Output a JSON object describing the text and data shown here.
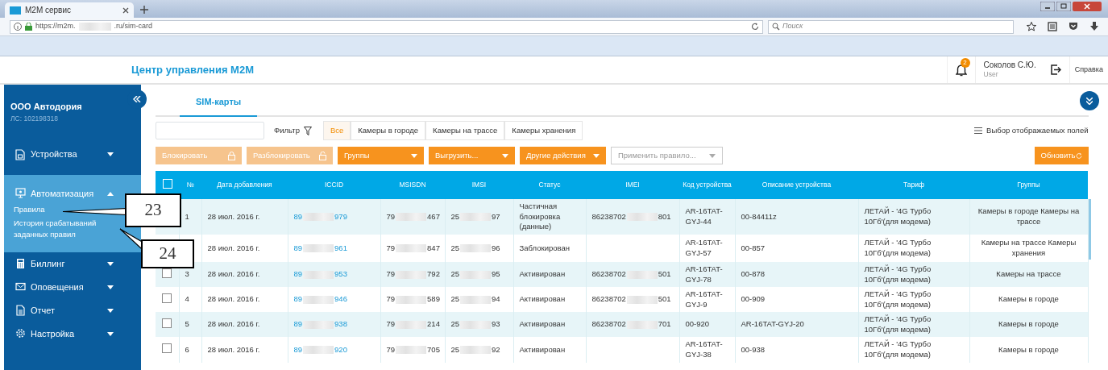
{
  "browser": {
    "tab_title": "M2M сервис",
    "url_start": "https://m2m.",
    "url_end": ".ru/sim-card",
    "search_placeholder": "Поиск"
  },
  "header": {
    "title": "Центр управления M2M",
    "notifications": "2",
    "user_name": "Соколов С.Ю.",
    "user_role": "User",
    "help": "Справка"
  },
  "sidebar": {
    "org": "ООО Автодория",
    "account": "ЛС: 102198318",
    "items": [
      {
        "label": "Устройства",
        "expanded": false
      },
      {
        "label": "Автоматизация",
        "expanded": true,
        "children": [
          {
            "label": "Правила"
          },
          {
            "label": "История срабатываний заданных правил"
          }
        ]
      },
      {
        "label": "Биллинг",
        "expanded": false
      },
      {
        "label": "Оповещения",
        "expanded": false
      },
      {
        "label": "Отчет",
        "expanded": false
      },
      {
        "label": "Настройка",
        "expanded": false
      }
    ]
  },
  "tabs": [
    {
      "label": "SIM-карты",
      "selected": true
    }
  ],
  "filter": {
    "label": "Фильтр",
    "segments": [
      {
        "label": "Все",
        "selected": true
      },
      {
        "label": "Камеры в городе",
        "selected": false
      },
      {
        "label": "Камеры на трассе",
        "selected": false
      },
      {
        "label": "Камеры хранения",
        "selected": false
      }
    ],
    "fields_link": "Выбор отображаемых полей"
  },
  "actions": [
    {
      "label": "Блокировать",
      "kind": "lock",
      "disabled": true
    },
    {
      "label": "Разблокировать",
      "kind": "unlock",
      "disabled": true
    },
    {
      "label": "Группы",
      "kind": "dropdown",
      "disabled": false
    },
    {
      "label": "Выгрузить...",
      "kind": "dropdown",
      "disabled": false
    },
    {
      "label": "Другие действия",
      "kind": "dropdown",
      "disabled": false
    }
  ],
  "rule_select": {
    "placeholder": "Применить правило..."
  },
  "refresh": "Обновить",
  "table": {
    "select_all_checked": false,
    "columns": [
      "№",
      "Дата добавления",
      "ICCID",
      "MSISDN",
      "IMSI",
      "Статус",
      "IMEI",
      "Код устройства",
      "Описание устройства",
      "Тариф",
      "Группы"
    ],
    "rows": [
      {
        "number": "1",
        "date": "28 июл. 2016 г.",
        "iccid": [
          "89",
          "979"
        ],
        "msisdn": [
          "79",
          "467"
        ],
        "imsi": [
          "25",
          "97"
        ],
        "status": "Частичная блокировка (данные)",
        "imei": [
          "86238702",
          "801"
        ],
        "code": "AR-16TAT-GYJ-44",
        "description": "00-84411z",
        "tariff": "ЛЕТАЙ - '4G Турбо 10Гб'(для модема)",
        "groups": "Камеры в городе Камеры на трассе"
      },
      {
        "date": "28 июл. 2016 г.",
        "iccid": [
          "89",
          "961"
        ],
        "msisdn": [
          "79",
          "847"
        ],
        "imsi": [
          "25",
          "96"
        ],
        "status": "Заблокирован",
        "code": "AR-16TAT-GYJ-57",
        "description": "00-857",
        "tariff": "ЛЕТАЙ - '4G Турбо 10Гб'(для модема)",
        "groups": "Камеры на трассе Камеры хранения"
      },
      {
        "checked": false,
        "number": "3",
        "date": "28 июл. 2016 г.",
        "iccid": [
          "89",
          "953"
        ],
        "msisdn": [
          "79",
          "792"
        ],
        "imsi": [
          "25",
          "95"
        ],
        "status": "Активирован",
        "imei": [
          "86238702",
          "501"
        ],
        "code": "AR-16TAT-GYJ-78",
        "description": "00-878",
        "tariff": "ЛЕТАЙ - '4G Турбо 10Гб'(для модема)",
        "groups": "Камеры на трассе"
      },
      {
        "checked": false,
        "number": "4",
        "date": "28 июл. 2016 г.",
        "iccid": [
          "89",
          "946"
        ],
        "msisdn": [
          "79",
          "589"
        ],
        "imsi": [
          "25",
          "94"
        ],
        "status": "Активирован",
        "imei": [
          "86238702",
          "501"
        ],
        "code": "AR-16TAT-GYJ-9",
        "description": "00-909",
        "tariff": "ЛЕТАЙ - '4G Турбо 10Гб'(для модема)",
        "groups": "Камеры в городе"
      },
      {
        "checked": false,
        "number": "5",
        "date": "28 июл. 2016 г.",
        "iccid": [
          "89",
          "938"
        ],
        "msisdn": [
          "79",
          "214"
        ],
        "imsi": [
          "25",
          "93"
        ],
        "status": "Активирован",
        "imei": [
          "86238702",
          "701"
        ],
        "code": "00-920",
        "description": "AR-16TAT-GYJ-20",
        "tariff": "ЛЕТАЙ - '4G Турбо 10Гб'(для модема)",
        "groups": "Камеры в городе"
      },
      {
        "checked": false,
        "number": "6",
        "date": "28 июл. 2016 г.",
        "iccid": [
          "89",
          "920"
        ],
        "msisdn": [
          "79",
          "705"
        ],
        "imsi": [
          "25",
          "92"
        ],
        "status": "Активирован",
        "code": "AR-16TAT-GYJ-38",
        "description": "00-938",
        "tariff": "ЛЕТАЙ - '4G Турбо 10Гб'(для модема)",
        "groups": "Камеры в городе"
      }
    ]
  },
  "callouts": [
    {
      "label": "23"
    },
    {
      "label": "24"
    }
  ]
}
